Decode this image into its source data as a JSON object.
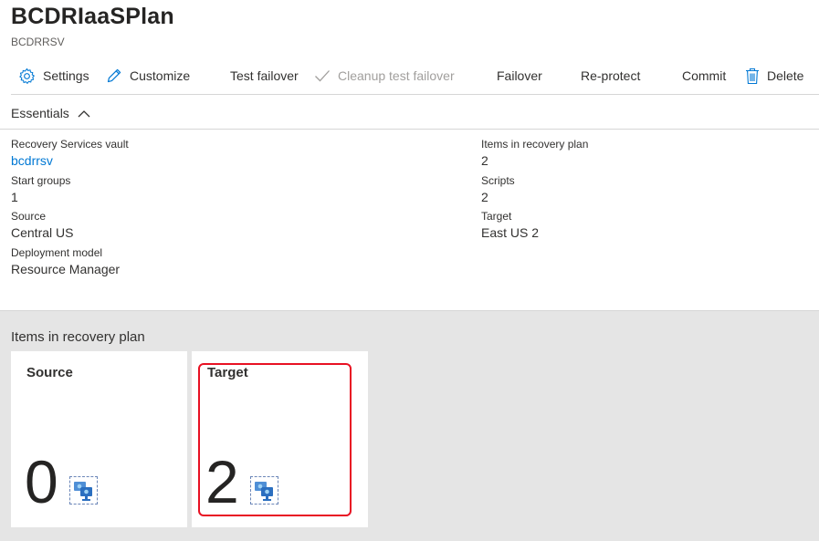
{
  "header": {
    "title": "BCDRIaaSPlan",
    "subtitle": "BCDRRSV"
  },
  "toolbar": {
    "settings": "Settings",
    "customize": "Customize",
    "test_failover": "Test failover",
    "cleanup_test_failover": "Cleanup test failover",
    "failover": "Failover",
    "reprotect": "Re-protect",
    "commit": "Commit",
    "delete": "Delete"
  },
  "essentials": {
    "toggle_label": "Essentials",
    "left": [
      {
        "label": "Recovery Services vault",
        "value": "bcdrrsv"
      },
      {
        "label": "Start groups",
        "value": "1"
      },
      {
        "label": "Source",
        "value": "Central US"
      },
      {
        "label": "Deployment model",
        "value": "Resource Manager"
      }
    ],
    "right": [
      {
        "label": "Items in recovery plan",
        "value": "2"
      },
      {
        "label": "Scripts",
        "value": "2"
      },
      {
        "label": "Target",
        "value": "East US 2"
      }
    ]
  },
  "items_section": {
    "title": "Items in recovery plan",
    "tiles": [
      {
        "title": "Source",
        "count": "0",
        "icon": "vm-group-icon"
      },
      {
        "title": "Target",
        "count": "2",
        "icon": "vm-group-icon"
      }
    ]
  },
  "colors": {
    "link": "#0078d4",
    "highlight": "#e81123",
    "panel_background": "#e5e5e5"
  }
}
